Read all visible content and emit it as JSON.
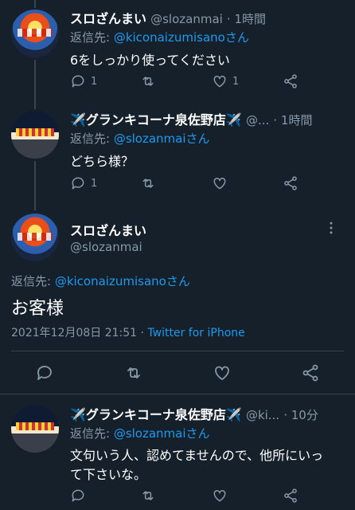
{
  "tweets": [
    {
      "display_name": "スロざんまい",
      "handle": "@slozanmai",
      "time": "· 1時間",
      "reply_prefix": "返信先: ",
      "reply_to": "@kiconaizumisanoさん",
      "text": "6をしっかり使ってください",
      "reply_count": "1",
      "like_count": "1"
    },
    {
      "display_name": "✈️グランキコーナ泉佐野店✈️",
      "handle": "@...",
      "time": "· 1時間",
      "reply_prefix": "返信先: ",
      "reply_to": "@slozanmaiさん",
      "text": "どちら様？",
      "reply_count": "1"
    }
  ],
  "main_tweet": {
    "display_name": "スロざんまい",
    "handle": "@slozanmai",
    "reply_prefix": "返信先: ",
    "reply_to": "@kiconaizumisanoさん",
    "text": "お客様",
    "timestamp": "2021年12月08日 21:51",
    "source": "Twitter for iPhone"
  },
  "reply_tweet": {
    "display_name": "✈️グランキコーナ泉佐野店✈️",
    "handle": "@ki...",
    "time": "· 10分",
    "reply_prefix": "返信先: ",
    "reply_to": "@slozanmaiさん",
    "text_line1": "文句いう人、認めてませんので、他所にいっ",
    "text_line2": "て下さいな。"
  },
  "icons": [
    "reply-icon",
    "retweet-icon",
    "like-icon",
    "share-icon",
    "more-icon"
  ],
  "colors": {
    "background": "#15202b",
    "link": "#1d9bf0",
    "muted": "#8899a6",
    "divider": "#38444d"
  }
}
